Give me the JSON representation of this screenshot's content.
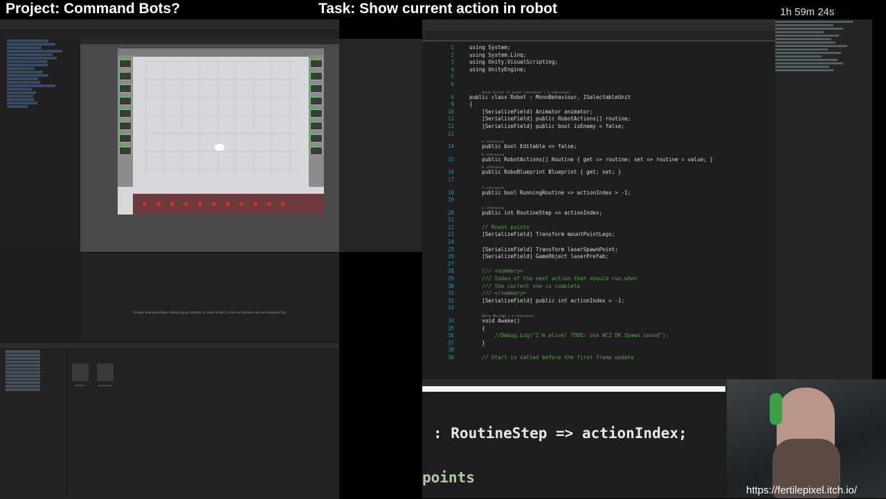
{
  "banner": {
    "project": "Project: Command Bots?",
    "task": "Task: Show current action in robot",
    "timer": "1h 59m 24s"
  },
  "code": {
    "lines": [
      {
        "n": "1",
        "t": "using System;",
        "ref": ""
      },
      {
        "n": "2",
        "t": "using System.Linq;",
        "ref": ""
      },
      {
        "n": "3",
        "t": "using Unity.VisualScripting;",
        "ref": ""
      },
      {
        "n": "4",
        "t": "using UnityEngine;",
        "ref": ""
      },
      {
        "n": "5",
        "t": "",
        "ref": ""
      },
      {
        "n": "6",
        "t": "",
        "ref": ""
      },
      {
        "n": "8",
        "t": "public class Robot : MonoBehaviour, ISelectableUnit",
        "ref": "Unity Script (1 asset reference) | 2 references"
      },
      {
        "n": "9",
        "t": "{",
        "ref": ""
      },
      {
        "n": "10",
        "t": "    [SerializeField] Animator animator;",
        "ref": ""
      },
      {
        "n": "11",
        "t": "    [SerializeField] public RobotActions[] routine;",
        "ref": ""
      },
      {
        "n": "12",
        "t": "    [SerializeField] public bool isEnemy = false;",
        "ref": ""
      },
      {
        "n": "13",
        "t": "",
        "ref": ""
      },
      {
        "n": "14",
        "t": "    public bool Editable => false;",
        "ref": "4 references"
      },
      {
        "n": "15",
        "t": "    public RobotActions[] Routine { get => routine; set => routine = value; }",
        "ref": "9 references"
      },
      {
        "n": "16",
        "t": "    public RoboBlueprint Blueprint { get; set; }",
        "ref": "8 references"
      },
      {
        "n": "17",
        "t": "",
        "ref": ""
      },
      {
        "n": "18",
        "t": "    public bool RunningRoutine => actionIndex > -1;",
        "ref": "3 references"
      },
      {
        "n": "19",
        "t": "",
        "ref": ""
      },
      {
        "n": "20",
        "t": "    public int RoutineStep => actionIndex;",
        "ref": "2 references"
      },
      {
        "n": "21",
        "t": "",
        "ref": ""
      },
      {
        "n": "22",
        "t": "    // Mount points",
        "ref": ""
      },
      {
        "n": "23",
        "t": "    [SerializeField] Transform mountPointLegs;",
        "ref": ""
      },
      {
        "n": "24",
        "t": "",
        "ref": ""
      },
      {
        "n": "25",
        "t": "    [SerializeField] Transform laserSpawnPoint;",
        "ref": ""
      },
      {
        "n": "26",
        "t": "    [SerializeField] GameObject laserPrefab;",
        "ref": ""
      },
      {
        "n": "27",
        "t": "",
        "ref": ""
      },
      {
        "n": "28",
        "t": "    /// <summary>",
        "ref": ""
      },
      {
        "n": "29",
        "t": "    /// Index of the next action that should run,when",
        "ref": ""
      },
      {
        "n": "30",
        "t": "    /// the current one is complete",
        "ref": ""
      },
      {
        "n": "31",
        "t": "    /// </summary>",
        "ref": ""
      },
      {
        "n": "32",
        "t": "    [SerializeField] public int actionIndex = -1;",
        "ref": ""
      },
      {
        "n": "33",
        "t": "",
        "ref": ""
      },
      {
        "n": "34",
        "t": "    void Awake()",
        "ref": "Unity Message | 0 references"
      },
      {
        "n": "35",
        "t": "    {",
        "ref": ""
      },
      {
        "n": "36",
        "t": "        //Debug.Log(\"I'm alive! TODO: use WC2 DK Spawn sound\");",
        "ref": ""
      },
      {
        "n": "37",
        "t": "    }",
        "ref": ""
      },
      {
        "n": "38",
        "t": "",
        "ref": ""
      },
      {
        "n": "39",
        "t": "    // Start is called before the first frame update",
        "ref": ""
      }
    ]
  },
  "zoom": {
    "line1": ": RoutineStep => actionIndex;",
    "line2": "points"
  },
  "unity": {
    "scene_message": "To begin animating Robot adding leg part prefabs to robots to start, create an Animator and an Animation Clip.",
    "assets": [
      "Blueprint",
      "StandardLegs"
    ]
  },
  "url": "https://fertilepixel.itch.io/"
}
